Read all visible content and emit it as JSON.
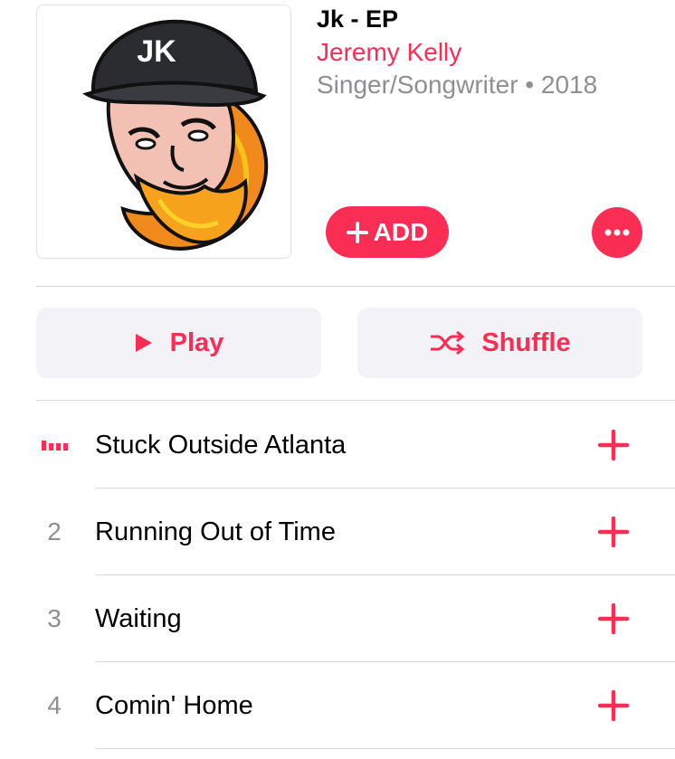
{
  "album": {
    "title": "Jk - EP",
    "artist": "Jeremy Kelly",
    "meta": "Singer/Songwriter • 2018",
    "artwork_hat_text": "JK"
  },
  "actions": {
    "add_label": "ADD",
    "add_icon": "plus-icon",
    "more_icon": "ellipsis-icon"
  },
  "controls": {
    "play_label": "Play",
    "shuffle_label": "Shuffle"
  },
  "tracks": [
    {
      "number": "",
      "title": "Stuck Outside Atlanta",
      "now_playing": true
    },
    {
      "number": "2",
      "title": "Running Out of Time",
      "now_playing": false
    },
    {
      "number": "3",
      "title": "Waiting",
      "now_playing": false
    },
    {
      "number": "4",
      "title": "Comin' Home",
      "now_playing": false
    }
  ],
  "colors": {
    "accent": "#fa2d55",
    "secondary_text": "#8e8e93",
    "pill_background": "#f2f2f7",
    "divider": "#d9d9de"
  }
}
